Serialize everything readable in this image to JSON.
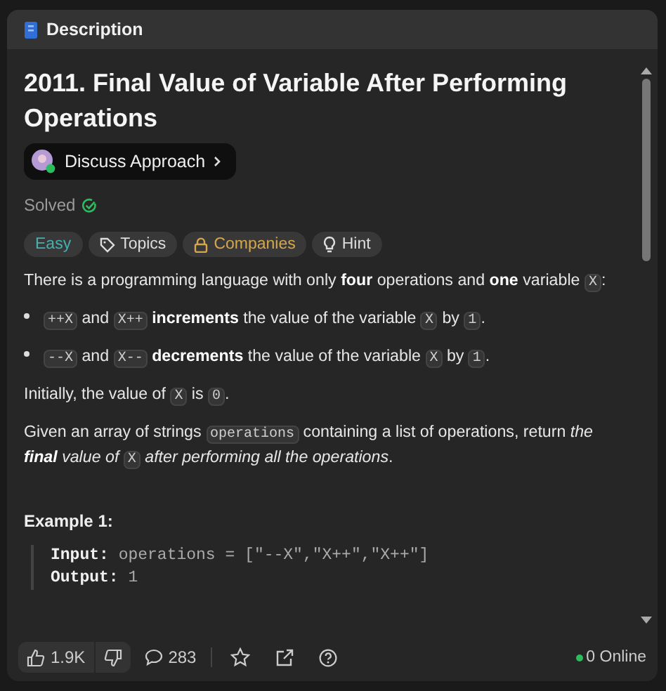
{
  "panel": {
    "tab": "Description"
  },
  "problem": {
    "title": "2011. Final Value of Variable After Performing Operations",
    "discuss": "Discuss Approach",
    "status": "Solved",
    "solved": true
  },
  "tags": [
    {
      "kind": "difficulty",
      "label": "Easy"
    },
    {
      "kind": "topics",
      "label": "Topics"
    },
    {
      "kind": "companies",
      "label": "Companies"
    },
    {
      "kind": "hint",
      "label": "Hint"
    }
  ],
  "description": [
    {
      "kind": "paragraph",
      "segments": [
        {
          "kind": "text",
          "text": "There is a programming language with only **four** operations and **one** variable "
        },
        {
          "kind": "code",
          "text": "X"
        },
        {
          "kind": "text",
          "text": ":"
        }
      ]
    },
    {
      "kind": "bullet",
      "segments": [
        {
          "kind": "code",
          "text": "++X"
        },
        {
          "kind": "text",
          "text": " and "
        },
        {
          "kind": "code",
          "text": "X++"
        },
        {
          "kind": "text",
          "text": " **increments** the value of the variable "
        },
        {
          "kind": "code",
          "text": "X"
        },
        {
          "kind": "text",
          "text": " by "
        },
        {
          "kind": "code",
          "text": "1"
        },
        {
          "kind": "text",
          "text": "."
        }
      ]
    },
    {
      "kind": "bullet",
      "segments": [
        {
          "kind": "code",
          "text": "--X"
        },
        {
          "kind": "text",
          "text": " and "
        },
        {
          "kind": "code",
          "text": "X--"
        },
        {
          "kind": "text",
          "text": " **decrements** the value of the variable "
        },
        {
          "kind": "code",
          "text": "X"
        },
        {
          "kind": "text",
          "text": " by "
        },
        {
          "kind": "code",
          "text": "1"
        },
        {
          "kind": "text",
          "text": "."
        }
      ]
    },
    {
      "kind": "paragraph",
      "segments": [
        {
          "kind": "text",
          "text": "Initially, the value of "
        },
        {
          "kind": "code",
          "text": "X"
        },
        {
          "kind": "text",
          "text": " is "
        },
        {
          "kind": "code",
          "text": "0"
        },
        {
          "kind": "text",
          "text": "."
        }
      ]
    },
    {
      "kind": "paragraph",
      "segments": [
        {
          "kind": "text",
          "text": "Given an array of strings "
        },
        {
          "kind": "code",
          "text": "operations"
        },
        {
          "kind": "text",
          "text": " containing a list of operations, return "
        },
        {
          "kind": "em",
          "text": "the **final** value of "
        },
        {
          "kind": "code",
          "text": "X"
        },
        {
          "kind": "em",
          "text": " after performing all the operations"
        },
        {
          "kind": "text",
          "text": "."
        }
      ]
    }
  ],
  "example": {
    "heading": "Example 1:",
    "lines": [
      {
        "label": "Input:",
        "value": "operations = [\"--X\",\"X++\",\"X++\"]"
      },
      {
        "label": "Output:",
        "value": "1"
      }
    ]
  },
  "footer": {
    "likes": "1.9K",
    "comments": "283",
    "online": "0 Online"
  }
}
